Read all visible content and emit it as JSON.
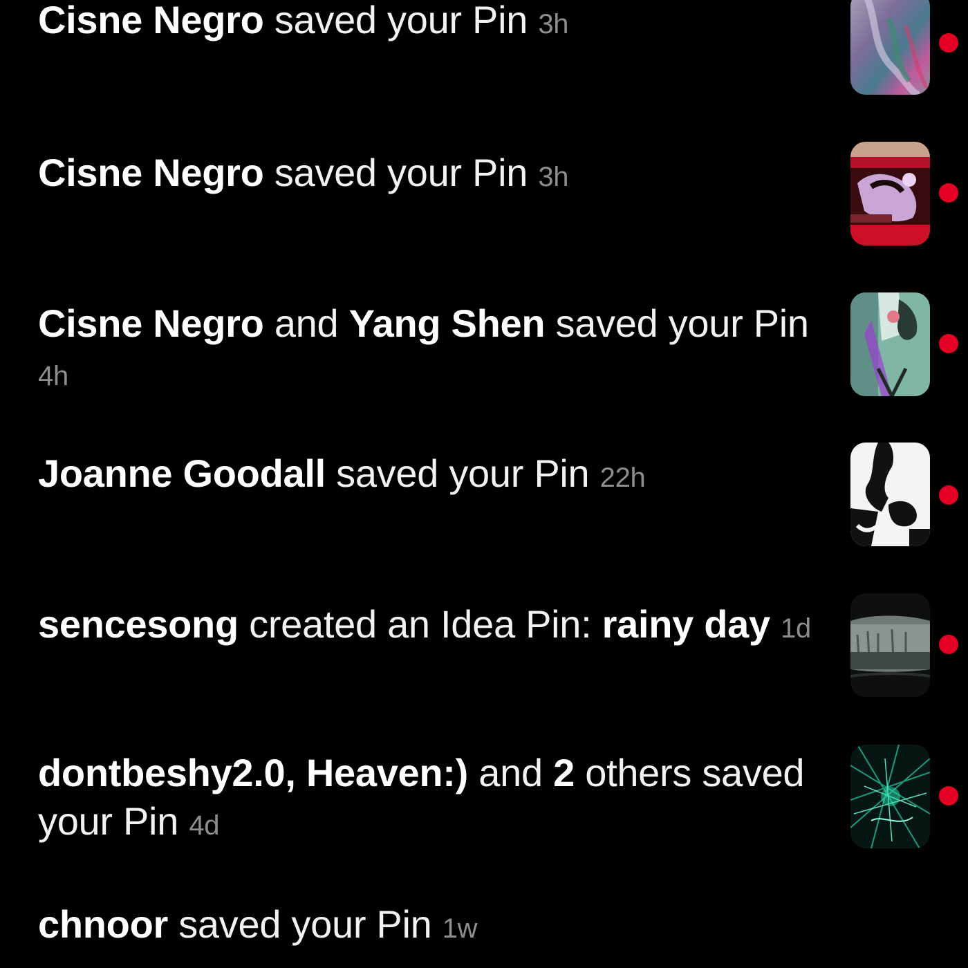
{
  "colors": {
    "background": "#000000",
    "text": "#f2f2f2",
    "time": "#8e8e8e",
    "unread_dot": "#e60023"
  },
  "notifications": [
    {
      "actor1": "Cisne Negro",
      "action": "saved your Pin",
      "time": "3h",
      "unread": true,
      "thumbnail_icon": "pin-thumbnail-1"
    },
    {
      "actor1": "Cisne Negro",
      "action": "saved your Pin",
      "time": "3h",
      "unread": true,
      "thumbnail_icon": "pin-thumbnail-2"
    },
    {
      "actor1": "Cisne Negro",
      "connector": "and",
      "actor2": "Yang Shen",
      "action": "saved your Pin",
      "time": "4h",
      "unread": true,
      "thumbnail_icon": "pin-thumbnail-3"
    },
    {
      "actor1": "Joanne Goodall",
      "action": "saved your Pin",
      "time": "22h",
      "unread": true,
      "thumbnail_icon": "pin-thumbnail-4"
    },
    {
      "actor1": "sencesong",
      "action": "created an Idea Pin:",
      "pin_title": "rainy day",
      "time": "1d",
      "unread": true,
      "thumbnail_icon": "pin-thumbnail-5"
    },
    {
      "actor1": "dontbeshy2.0, Heaven:)",
      "connector": "and",
      "count": "2",
      "action": "others saved your Pin",
      "time": "4d",
      "unread": true,
      "thumbnail_icon": "pin-thumbnail-6"
    },
    {
      "actor1": "chnoor",
      "action": "saved your Pin",
      "time": "1w",
      "unread": false
    }
  ]
}
